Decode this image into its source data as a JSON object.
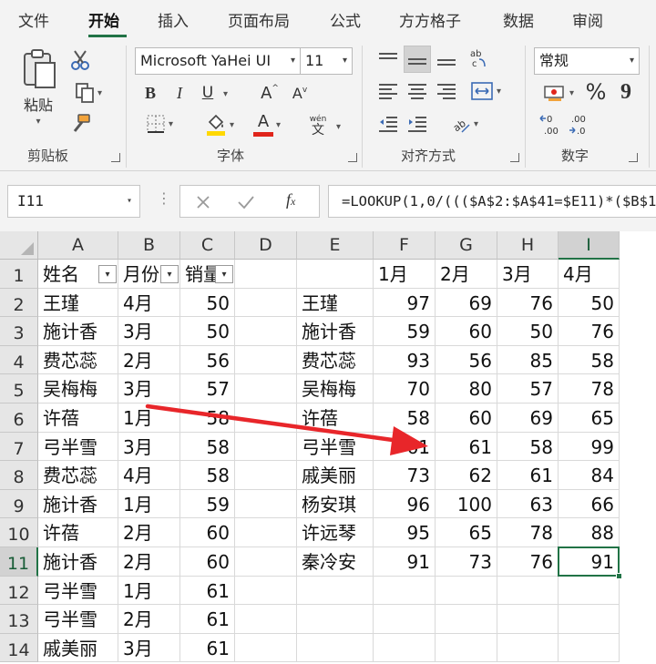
{
  "ribbon_tabs": [
    "文件",
    "开始",
    "插入",
    "页面布局",
    "公式",
    "方方格子",
    "数据",
    "审阅"
  ],
  "active_tab": "开始",
  "clipboard": {
    "paste_label": "粘贴",
    "group_label": "剪贴板"
  },
  "font": {
    "name": "Microsoft YaHei UI",
    "size": "11",
    "bold": "B",
    "italic": "I",
    "underline": "U",
    "grow": "A",
    "shrink": "A",
    "phonetic": "wén",
    "phonetic_char": "文",
    "font_color_letter": "A",
    "group_label": "字体"
  },
  "alignment": {
    "group_label": "对齐方式"
  },
  "number": {
    "format": "常规",
    "percent": "%",
    "comma": "9",
    "group_label": "数字"
  },
  "formula_bar": {
    "name_box": "I11",
    "formula": "=LOOKUP(1,0/((($A$2:$A$41=$E11)*($B$1"
  },
  "colors": {
    "accent": "#217346",
    "arrow": "#e8262a",
    "fill_yellow": "#ffd800",
    "font_red": "#e0251b"
  },
  "sheet": {
    "columns": [
      "A",
      "B",
      "C",
      "D",
      "E",
      "F",
      "G",
      "H",
      "I"
    ],
    "selected_column": "I",
    "selected_row": "11",
    "rows": [
      {
        "n": "1",
        "a": "姓名",
        "b": "月份",
        "c": "销量",
        "d": "",
        "e": "",
        "f": "1月",
        "g": "2月",
        "h": "3月",
        "i": "4月"
      },
      {
        "n": "2",
        "a": "王瑾",
        "b": "4月",
        "c": "50",
        "d": "",
        "e": "王瑾",
        "f": "97",
        "g": "69",
        "h": "76",
        "i": "50"
      },
      {
        "n": "3",
        "a": "施计香",
        "b": "3月",
        "c": "50",
        "d": "",
        "e": "施计香",
        "f": "59",
        "g": "60",
        "h": "50",
        "i": "76"
      },
      {
        "n": "4",
        "a": "费芯蕊",
        "b": "2月",
        "c": "56",
        "d": "",
        "e": "费芯蕊",
        "f": "93",
        "g": "56",
        "h": "85",
        "i": "58"
      },
      {
        "n": "5",
        "a": "吴梅梅",
        "b": "3月",
        "c": "57",
        "d": "",
        "e": "吴梅梅",
        "f": "70",
        "g": "80",
        "h": "57",
        "i": "78"
      },
      {
        "n": "6",
        "a": "许蓓",
        "b": "1月",
        "c": "58",
        "d": "",
        "e": "许蓓",
        "f": "58",
        "g": "60",
        "h": "69",
        "i": "65"
      },
      {
        "n": "7",
        "a": "弓半雪",
        "b": "3月",
        "c": "58",
        "d": "",
        "e": "弓半雪",
        "f": "61",
        "g": "61",
        "h": "58",
        "i": "99"
      },
      {
        "n": "8",
        "a": "费芯蕊",
        "b": "4月",
        "c": "58",
        "d": "",
        "e": "戚美丽",
        "f": "73",
        "g": "62",
        "h": "61",
        "i": "84"
      },
      {
        "n": "9",
        "a": "施计香",
        "b": "1月",
        "c": "59",
        "d": "",
        "e": "杨安琪",
        "f": "96",
        "g": "100",
        "h": "63",
        "i": "66"
      },
      {
        "n": "10",
        "a": "许蓓",
        "b": "2月",
        "c": "60",
        "d": "",
        "e": "许远琴",
        "f": "95",
        "g": "65",
        "h": "78",
        "i": "88"
      },
      {
        "n": "11",
        "a": "施计香",
        "b": "2月",
        "c": "60",
        "d": "",
        "e": "秦冷安",
        "f": "91",
        "g": "73",
        "h": "76",
        "i": "91"
      },
      {
        "n": "12",
        "a": "弓半雪",
        "b": "1月",
        "c": "61",
        "d": "",
        "e": "",
        "f": "",
        "g": "",
        "h": "",
        "i": ""
      },
      {
        "n": "13",
        "a": "弓半雪",
        "b": "2月",
        "c": "61",
        "d": "",
        "e": "",
        "f": "",
        "g": "",
        "h": "",
        "i": ""
      },
      {
        "n": "14",
        "a": "戚美丽",
        "b": "3月",
        "c": "61",
        "d": "",
        "e": "",
        "f": "",
        "g": "",
        "h": "",
        "i": ""
      }
    ]
  }
}
